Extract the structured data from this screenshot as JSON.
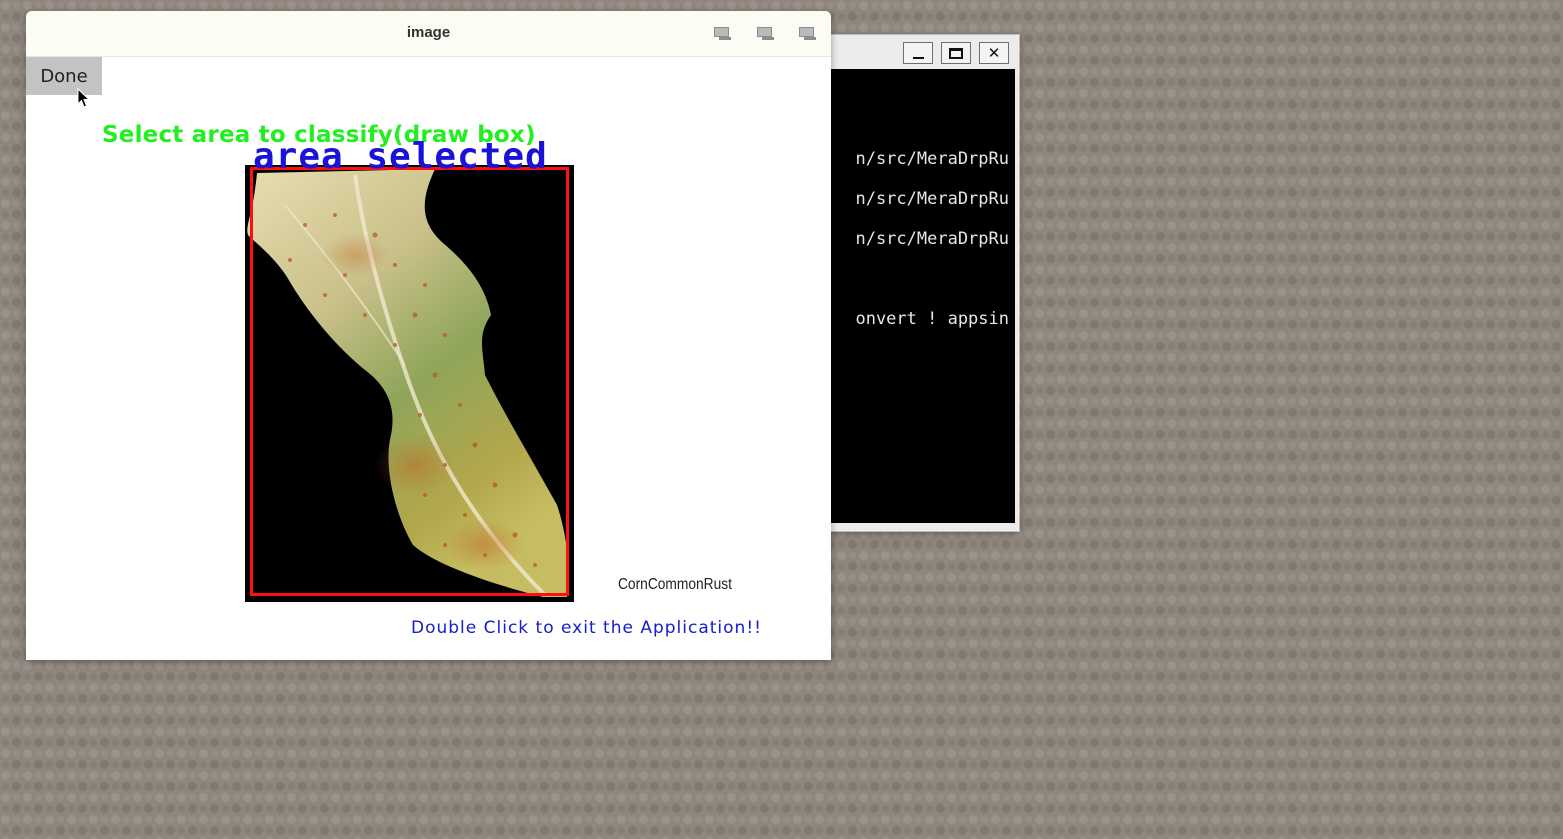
{
  "terminal": {
    "lines": [
      "n/src/MeraDrpRu",
      "n/src/MeraDrpRu",
      "n/src/MeraDrpRu",
      "onvert ! appsin"
    ]
  },
  "image_window": {
    "title": "image",
    "done_label": "Done",
    "prompt_text": "Select area to classify(draw box)",
    "status_text": "area selected",
    "class_label": "CornCommonRust",
    "exit_text": "Double Click to exit the Application!!"
  },
  "colors": {
    "prompt": "#22ee22",
    "status": "#1a12d6",
    "selection_box": "#ff1010",
    "exit_text": "#1520c8"
  }
}
